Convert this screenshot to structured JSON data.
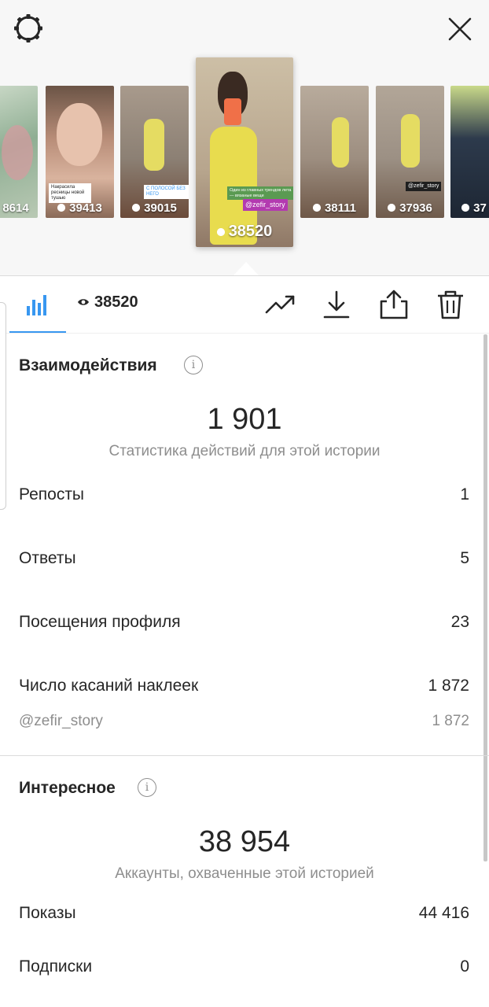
{
  "header": {
    "settings_icon": "gear-icon",
    "close_icon": "close-icon"
  },
  "stories": [
    {
      "views": "8614",
      "tag": "",
      "bg": "#9bb39a"
    },
    {
      "views": "39413",
      "tag": "Накрасила ресницы новой тушью",
      "bg": "#8a6a58"
    },
    {
      "views": "39015",
      "tag": "С ПОЛОСОЙ  БЕЗ НЕГО",
      "bg": "#b39b86"
    },
    {
      "views": "38520",
      "tag": "@zefir_story",
      "bg": "#c9b79a",
      "selected": true
    },
    {
      "views": "38111",
      "tag": "",
      "bg": "#a4978a"
    },
    {
      "views": "37936",
      "tag": "@zefir_story",
      "bg": "#a49a8e"
    },
    {
      "views": "37",
      "tag": "",
      "bg": "#6f7f92"
    }
  ],
  "selected_story": {
    "caption": "Один из главных трендов лета — вязаные вещи",
    "mention": "@zefir_story"
  },
  "toolbar": {
    "views": "38520",
    "icons": [
      "bar-chart-icon",
      "eye-icon",
      "trending-icon",
      "download-icon",
      "share-icon",
      "trash-icon"
    ],
    "accent": "#3897f0"
  },
  "interactions": {
    "title": "Взаимодействия",
    "total": "1 901",
    "caption": "Статистика действий для этой истории",
    "rows": [
      {
        "label": "Репосты",
        "value": "1"
      },
      {
        "label": "Ответы",
        "value": "5"
      },
      {
        "label": "Посещения профиля",
        "value": "23"
      },
      {
        "label": "Число касаний наклеек",
        "value": "1 872"
      }
    ],
    "sub_row": {
      "label": "@zefir_story",
      "value": "1 872"
    }
  },
  "discovery": {
    "title": "Интересное",
    "total": "38 954",
    "caption": "Аккаунты, охваченные этой историей",
    "rows": [
      {
        "label": "Показы",
        "value": "44 416"
      },
      {
        "label": "Подписки",
        "value": "0"
      }
    ]
  }
}
